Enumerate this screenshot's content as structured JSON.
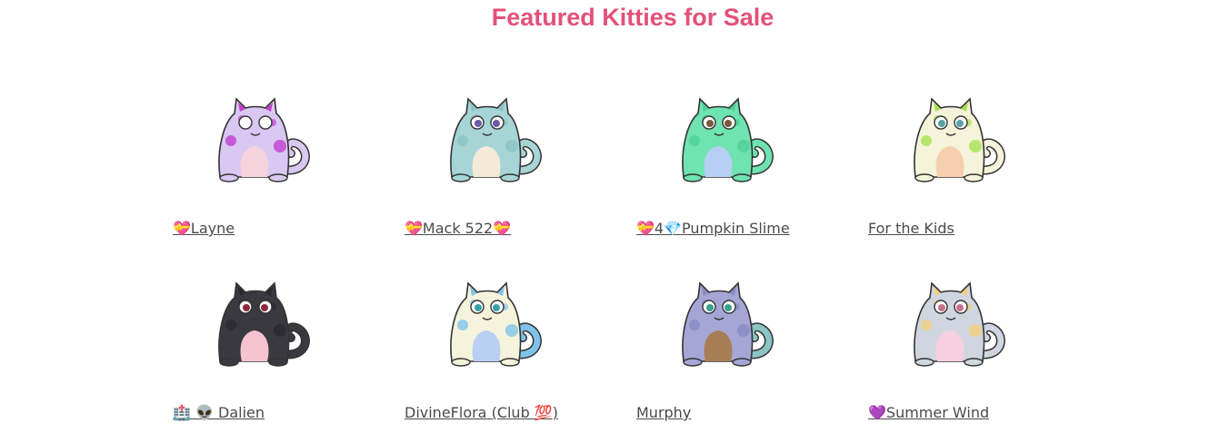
{
  "section": {
    "title": "Featured Kitties for Sale"
  },
  "kitties": [
    {
      "name": "💝Layne",
      "icon": "kitty-purple-spotted",
      "body_color": "#d9c8f2",
      "pattern_color": "#c23fd1",
      "belly_color": "#f6d3dc",
      "eye_color": "#ffffff",
      "tail_color": "#d9c8f2"
    },
    {
      "name": "💝Mack 522💝",
      "icon": "kitty-teal",
      "body_color": "#a7d5d6",
      "pattern_color": "#8cc3c5",
      "belly_color": "#f3ead7",
      "eye_color": "#6a5aa8",
      "tail_color": "#a7d5d6"
    },
    {
      "name": "💝4💎Pumpkin Slime",
      "icon": "kitty-mint",
      "body_color": "#6fe3b2",
      "pattern_color": "#4fcf97",
      "belly_color": "#b6cff3",
      "eye_color": "#7a5a3a",
      "tail_color": "#6fe3b2"
    },
    {
      "name": "For the Kids",
      "icon": "kitty-lime-spotted",
      "body_color": "#f5f3da",
      "pattern_color": "#a6e350",
      "belly_color": "#f6cfae",
      "eye_color": "#5aa0a8",
      "tail_color": "#f5f3da"
    },
    {
      "name": "🏥 👽 Dalien",
      "icon": "kitty-black",
      "body_color": "#3a3940",
      "pattern_color": "#2a2930",
      "belly_color": "#f6c3d0",
      "eye_color": "#8a2a3a",
      "tail_color": "#3a3940"
    },
    {
      "name": "DivineFlora (Club 💯)",
      "icon": "kitty-blue-striped",
      "body_color": "#f6f3dc",
      "pattern_color": "#7fc3ea",
      "belly_color": "#b9d0f2",
      "eye_color": "#3aa0a8",
      "tail_color": "#7fc3ea"
    },
    {
      "name": "Murphy",
      "icon": "kitty-lavender",
      "body_color": "#a6a6d6",
      "pattern_color": "#8a8ac3",
      "belly_color": "#a97e56",
      "eye_color": "#3aa08a",
      "tail_color": "#8cc3c5"
    },
    {
      "name": "💜Summer Wind",
      "icon": "kitty-grey-horned",
      "body_color": "#cfd6e0",
      "pattern_color": "#f3d07a",
      "belly_color": "#f6cfe0",
      "eye_color": "#c8708a",
      "tail_color": "#cfd6e0"
    }
  ]
}
